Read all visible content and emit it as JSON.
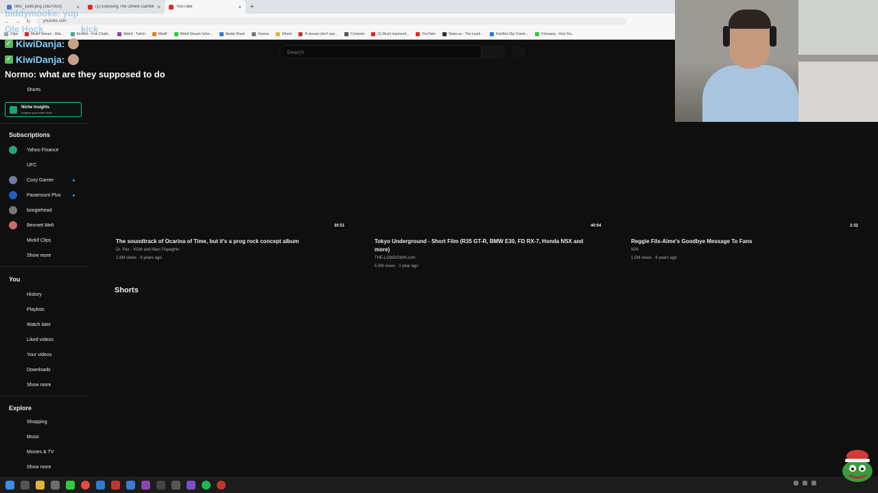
{
  "browser": {
    "tabs": [
      {
        "title": "IMG_1598.png (161×353)",
        "active": false
      },
      {
        "title": "(1) Exposing The Online Gambli",
        "active": false
      },
      {
        "title": "YouTube",
        "active": true
      }
    ],
    "url": "youtube.com",
    "bookmarks": [
      "Clips",
      "Mizkif Stream - Wat...",
      "KickBot - Kick Chatb...",
      "Mizkif - Twitch",
      "Mizkif",
      "Mizkif Stream Sche...",
      "Media Share",
      "Games",
      "Wheel",
      "R stream (don't ope...",
      "Contexto",
      "(1) Much improved...",
      "YouTube",
      "Stake.us - The Leadi...",
      "KickBot Clip Comm...",
      "Kickaway - Kick Giv..."
    ]
  },
  "search": {
    "placeholder": "Search"
  },
  "chat": {
    "ghost_1": "biddymooke: yup",
    "ghost_2": "Ole Hock",
    "ghost_3": "kick",
    "line1_user": "KiwiDanja:",
    "line2_user": "KiwiDanja:",
    "line3_user": "Normo:",
    "line3_msg": "what are they supposed to do"
  },
  "sidebar": {
    "shorts": "Shorts",
    "niche_title": "Niche Insights",
    "niche_sub": "Analyze your entire niche",
    "subscriptions_head": "Subscriptions",
    "subscriptions": [
      {
        "label": "Yahoo Finance",
        "color": "#2aa37a",
        "dot": false
      },
      {
        "label": "UFC",
        "color": "",
        "dot": false
      },
      {
        "label": "Cozy Gamer",
        "color": "#6a7fa0",
        "dot": true
      },
      {
        "label": "Paramount Plus",
        "color": "#1f5fc7",
        "dot": true
      },
      {
        "label": "boogiehead",
        "color": "#777777",
        "dot": false
      },
      {
        "label": "Bennett Melt",
        "color": "#c96a6a",
        "dot": false
      },
      {
        "label": "Mizkif Clips",
        "color": "",
        "dot": false
      }
    ],
    "sub_show_more": "Show more",
    "you_head": "You",
    "you_items": [
      "History",
      "Playlists",
      "Watch later",
      "Liked videos",
      "Your videos",
      "Downloads"
    ],
    "you_show_more": "Show more",
    "explore_head": "Explore",
    "explore_items": [
      "Shopping",
      "Music",
      "Movies & TV"
    ],
    "explore_show_more": "Show more"
  },
  "videos": [
    {
      "duration": "30:51",
      "title_1": "The soundtrack of Ocarina of Time, but it's a prog rock concept album",
      "title_2": "",
      "channel": "Dr. Pez - VGM     and Marc Papeghin",
      "meta": "2.8M views · 8 years ago"
    },
    {
      "duration": "40:04",
      "title_1": "Tokyo Underground - Short Film (R35 GT-R, BMW E30, FD RX-7, Honda NSX and",
      "title_2": "more)",
      "channel": "THE-LOWDOWN.com",
      "meta": "5.5M views · 1 year ago"
    },
    {
      "duration": "2:32",
      "title_1": "Reggie Fils-Aime's Goodbye Message To Fans",
      "title_2": "",
      "channel": "IGN",
      "meta": "1.5M views · 6 years ago"
    }
  ],
  "shorts_heading": "Shorts",
  "colors": {
    "accent": "#3ea6ff",
    "niche_border": "#1ec78f",
    "background": "#0f0f0f"
  }
}
